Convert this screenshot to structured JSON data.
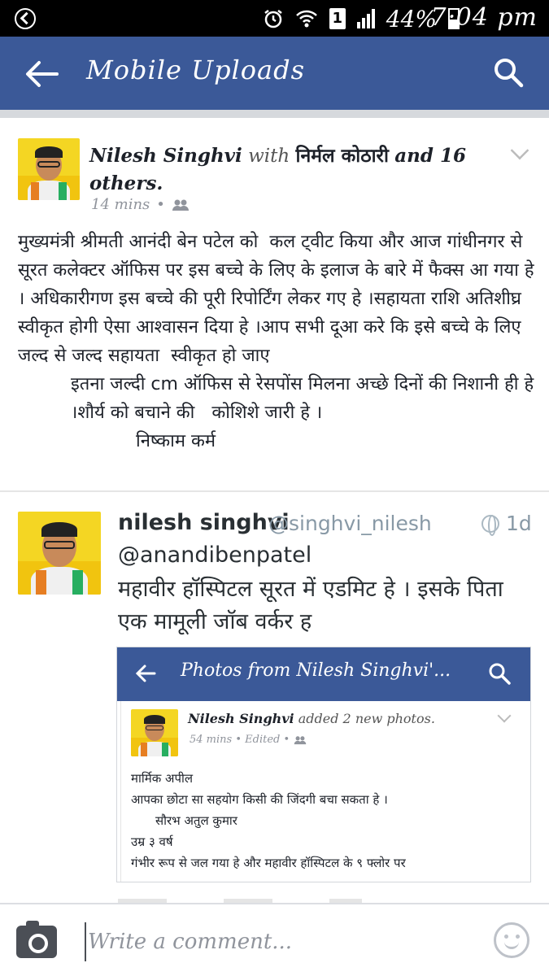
{
  "status_bar": {
    "battery_percent": "44%",
    "time": "7:04 pm",
    "sim_slot": "1",
    "icons": [
      "sync-icon",
      "alarm-icon",
      "wifi-icon",
      "sim-icon",
      "signal-icon",
      "battery-icon"
    ]
  },
  "header": {
    "title": "Mobile Uploads",
    "icons": [
      "back-arrow-icon",
      "search-icon"
    ]
  },
  "post": {
    "author": "Nilesh Singhvi",
    "with_word": "with",
    "tagged": "निर्मल कोठारी",
    "and_others": "and 16 others.",
    "time": "14 mins",
    "dot": "•",
    "audience_icon": "friends-icon",
    "body_lines": [
      "मुख्यमंत्री श्रीमती आनंदी बेन पटेल को  कल ट्वीट किया और आज गांधीनगर से सूरत कलेक्टर ऑफिस पर इस बच्चे के लिए के इलाज के बारे में फैक्स आ गया हे । अधिकारीगण इस बच्चे की पूरी रिपोर्टिंग लेकर गए हे ।सहायता राशि अतिशीघ्र स्वीकृत होगी ऐसा आश्वासन दिया हे ।आप सभी दूआ करे कि इसे बच्चे के लिए  जल्द से जल्द सहायता  स्वीकृत हो जाए",
      "इतना जल्दी cm ऑफिस से रेसपोंस मिलना अच्छे दिनों की निशानी ही हे ।शौर्य को बचाने की   कोशिशे जारी हे ।",
      "निष्काम कर्म"
    ]
  },
  "tweet": {
    "name": "nilesh singhvi",
    "handle": "@singhvi_nilesh",
    "age": "1d",
    "mention": "@anandibenpatel",
    "text": "महावीर हॉस्पिटल सूरत में एडमिट हे । इसके पिता एक मामूली जॉब वर्कर ह"
  },
  "nested_screenshot": {
    "bar_title": "Photos from Nilesh Singhvi'...",
    "author": "Nilesh Singhvi",
    "action": "added 2 new photos.",
    "meta": "54 mins • Edited •",
    "lines": [
      "मार्मिक अपील",
      "आपका छोटा सा सहयोग किसी की जिंदगी बचा सकता हे ।",
      "सौरभ अतुल कुमार",
      "उम्र ३ वर्ष",
      "गंभीर रूप से जल गया हे और महावीर हॉस्पिटल के ९ फ्लोर पर"
    ]
  },
  "comment_bar": {
    "placeholder": "Write a comment...",
    "icons": [
      "camera-icon",
      "emoji-icon"
    ]
  },
  "colors": {
    "facebook_blue": "#3b5998",
    "status_bar": "#000000",
    "background": "#e9ebee",
    "avatar_yellow": "#f4d623"
  }
}
